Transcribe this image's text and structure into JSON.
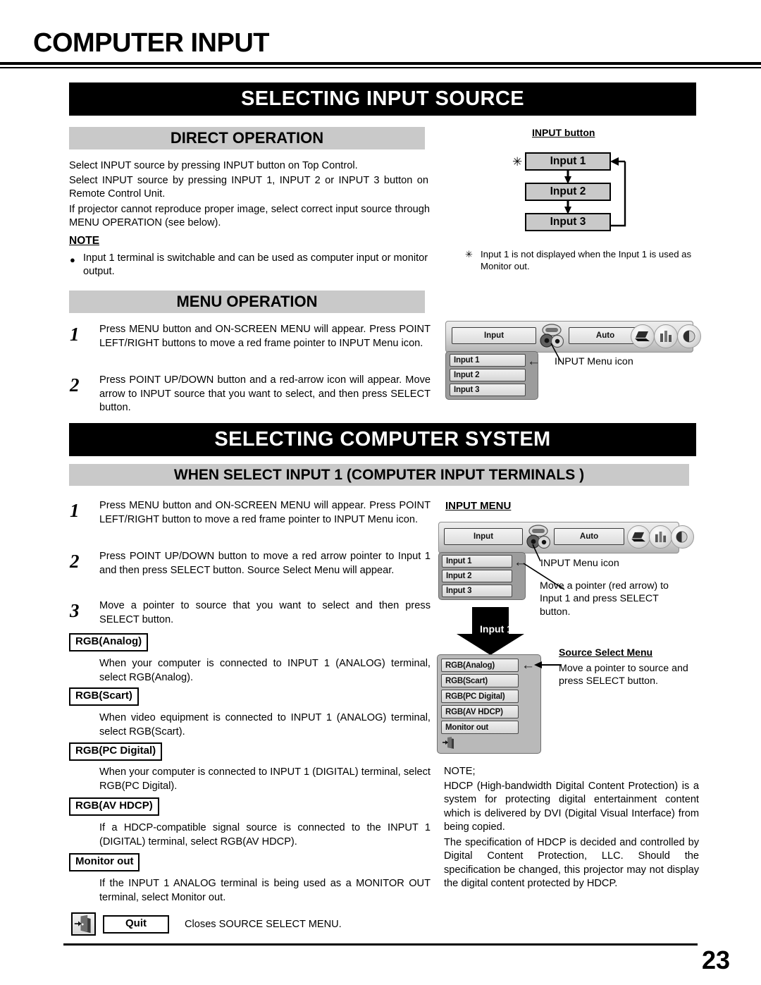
{
  "page": {
    "title": "COMPUTER INPUT",
    "number": "23"
  },
  "sections": {
    "selecting_input_source": {
      "banner": "SELECTING INPUT SOURCE",
      "direct_operation": {
        "heading": "DIRECT OPERATION",
        "paragraphs": [
          "Select INPUT source by pressing INPUT button on Top Control.",
          "Select INPUT source by pressing INPUT 1, INPUT 2 or INPUT 3 button on Remote Control Unit.",
          "If projector cannot reproduce proper image, select correct input source through MENU OPERATION (see below)."
        ],
        "note_title": "NOTE",
        "note_bullet": "●",
        "note_items": [
          "Input 1 terminal is switchable and can be used as computer input or monitor output."
        ]
      },
      "menu_operation": {
        "heading": "MENU OPERATION",
        "steps": [
          {
            "num": "1",
            "text": "Press MENU button and ON-SCREEN MENU will appear.  Press POINT LEFT/RIGHT buttons to move a red frame pointer to INPUT Menu icon."
          },
          {
            "num": "2",
            "text": "Press POINT UP/DOWN button and a red-arrow icon will appear.  Move arrow to INPUT source that you want to select, and then press SELECT button."
          }
        ]
      },
      "input_button_diagram": {
        "label": "INPUT button",
        "asterisk": "✳",
        "boxes": [
          "Input 1",
          "Input 2",
          "Input 3"
        ],
        "footnote_marker": "✳",
        "footnote": "Input 1 is not displayed when the Input 1 is used as Monitor out."
      },
      "menu_mockup": {
        "input_button": "Input",
        "auto_button": "Auto",
        "items": [
          "Input 1",
          "Input 2",
          "Input 3"
        ],
        "arrow": "←",
        "callout": "INPUT Menu icon"
      }
    },
    "selecting_computer_system": {
      "banner": "SELECTING COMPUTER SYSTEM",
      "subheading": "WHEN SELECT  INPUT 1 (COMPUTER INPUT TERMINALS )",
      "steps": [
        {
          "num": "1",
          "text": "Press MENU button and ON-SCREEN MENU will appear.  Press POINT LEFT/RIGHT button to move a red frame pointer to INPUT Menu icon."
        },
        {
          "num": "2",
          "text": "Press POINT UP/DOWN button to move a red arrow pointer to Input 1 and then press SELECT button.  Source Select Menu will appear."
        },
        {
          "num": "3",
          "text": "Move a pointer to source that you want to select and then press SELECT button."
        }
      ],
      "options": [
        {
          "label": "RGB(Analog)",
          "desc": "When your computer is connected to INPUT 1 (ANALOG) terminal, select RGB(Analog)."
        },
        {
          "label": "RGB(Scart)",
          "desc": "When video equipment is connected to INPUT 1 (ANALOG) terminal, select RGB(Scart)."
        },
        {
          "label": "RGB(PC Digital)",
          "desc": "When your computer is connected to INPUT 1 (DIGITAL) terminal, select RGB(PC Digital)."
        },
        {
          "label": "RGB(AV HDCP)",
          "desc": "If a HDCP-compatible signal source is connected to the INPUT 1 (DIGITAL) terminal, select RGB(AV HDCP)."
        },
        {
          "label": "Monitor out",
          "desc": "If the INPUT 1 ANALOG terminal is being used as a MONITOR OUT terminal, select Monitor out."
        }
      ],
      "quit_row": {
        "icon_name": "quit-door-icon",
        "label": "Quit",
        "desc": "Closes SOURCE SELECT MENU."
      },
      "input_menu_diagram": {
        "title": "INPUT MENU",
        "input_button": "Input",
        "auto_button": "Auto",
        "items": [
          "Input 1",
          "Input 2",
          "Input 3"
        ],
        "arrow": "←",
        "callout_icon": "INPUT Menu icon",
        "callout_pointer": "Move a pointer (red arrow) to Input 1 and press SELECT button."
      },
      "source_select_menu": {
        "big_arrow_label": "Input 1",
        "title": "Source Select Menu",
        "items": [
          "RGB(Analog)",
          "RGB(Scart)",
          "RGB(PC Digital)",
          "RGB(AV HDCP)",
          "Monitor out"
        ],
        "arrow": "←",
        "callout": "Move a pointer to source and press SELECT button."
      },
      "hdcp_note": {
        "title": "NOTE;",
        "paragraphs": [
          "HDCP (High-bandwidth Digital Content Protection) is a system for protecting digital entertainment content which is delivered by DVI (Digital Visual Interface) from being copied.",
          "The specification of HDCP is decided and controlled by Digital Content Protection, LLC. Should the specification be changed, this projector may not display the digital content protected by HDCP."
        ]
      }
    }
  },
  "colors": {
    "banner_bg": "#000000",
    "banner_fg": "#ffffff",
    "subhead_bg": "#c9c9c9",
    "osd_panel": "#9c9c9c"
  }
}
